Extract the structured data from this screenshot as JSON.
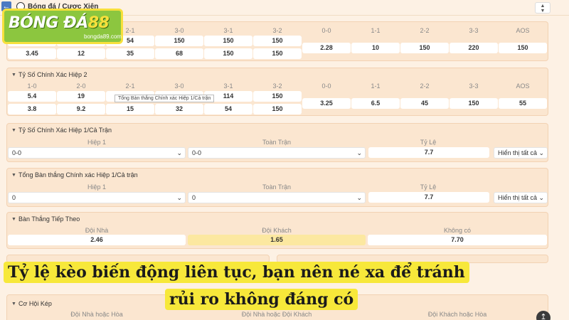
{
  "header": {
    "breadcrumb": "Bóng đá / Cược Xiên"
  },
  "logo": {
    "text": "BÓNG ĐÁ",
    "num": "88",
    "sub": "bongda89.com"
  },
  "p1": {
    "labels": [
      "",
      "",
      "2-1",
      "3-0",
      "3-1",
      "3-2",
      "0-0",
      "1-1",
      "2-2",
      "3-3",
      "AOS"
    ],
    "row1": [
      "",
      "",
      "54",
      "150",
      "150",
      "150",
      "2.28",
      "10",
      "150",
      "220",
      "150"
    ],
    "row2": [
      "3.45",
      "12",
      "35",
      "68",
      "150",
      "150"
    ]
  },
  "p2": {
    "title": "Tỷ Số Chính Xác Hiệp 2",
    "labels": [
      "1-0",
      "2-0",
      "2-1",
      "3-0",
      "3-1",
      "3-2",
      "0-0",
      "1-1",
      "2-2",
      "3-3",
      "AOS"
    ],
    "row1": [
      "5.4",
      "19",
      "",
      "",
      "114",
      "150",
      "3.25",
      "6.5",
      "45",
      "150",
      "55"
    ],
    "row2": [
      "3.8",
      "9.2",
      "15",
      "32",
      "54",
      "150"
    ],
    "tooltip": "Tổng Bàn thắng Chính xác Hiệp 1/Cả trận"
  },
  "p3": {
    "title": "Tỷ Số Chính Xác Hiệp 1/Cả Trận",
    "label_a": "Hiệp 1",
    "label_b": "Toàn Trận",
    "label_c": "Tỷ Lệ",
    "select_a": "0-0",
    "select_b": "0-0",
    "odds": "7.7",
    "show": "Hiển thị tất cả"
  },
  "p4": {
    "title": "Tổng Bàn thắng Chính xác Hiệp 1/Cả trận",
    "label_a": "Hiệp 1",
    "label_b": "Toàn Trận",
    "label_c": "Tỷ Lệ",
    "select_a": "0",
    "select_b": "0",
    "odds": "7.7",
    "show": "Hiển thị tất cả"
  },
  "p5": {
    "title": "Bàn Thắng Tiếp Theo",
    "labels": [
      "Đội Nhà",
      "Đội Khách",
      "Không có"
    ],
    "values": [
      "2.46",
      "1.65",
      "7.70"
    ]
  },
  "p7": {
    "title": "Cơ Hội Kép",
    "labels": [
      "Đội Nhà hoặc Hòa",
      "Đội Nhà hoặc Đội Khách",
      "Đội Khách hoặc Hòa"
    ]
  },
  "banner": {
    "line1": "Tỷ lệ kèo biến động liên tục, bạn nên né xa để tránh",
    "line2": "rủi ro không đáng có"
  },
  "colors": {
    "accent": "#f7e83a",
    "panel": "#fbe6d0",
    "highlight": "#fce8a0"
  }
}
